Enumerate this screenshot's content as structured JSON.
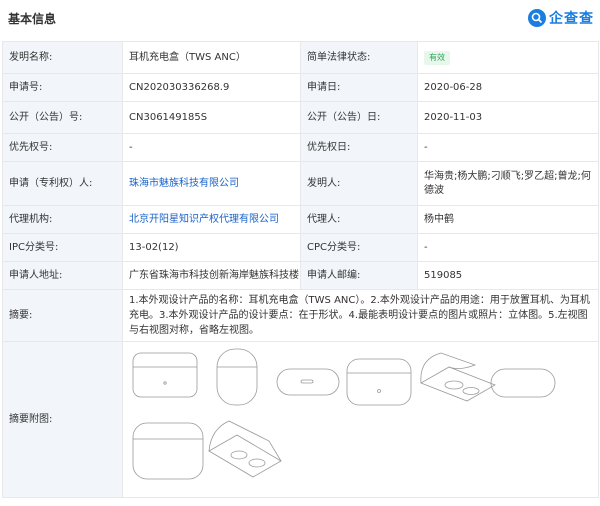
{
  "header": {
    "title": "基本信息",
    "brand": "企查查"
  },
  "rows": {
    "design_name_label": "发明名称:",
    "design_name": "耳机充电盒（TWS ANC）",
    "legal_status_label": "简单法律状态:",
    "legal_status": "有效",
    "app_no_label": "申请号:",
    "app_no": "CN202030336268.9",
    "app_date_label": "申请日:",
    "app_date": "2020-06-28",
    "pub_no_label": "公开（公告）号:",
    "pub_no": "CN306149185S",
    "pub_date_label": "公开（公告）日:",
    "pub_date": "2020-11-03",
    "priority_label": "优先权号:",
    "priority": "-",
    "priority_date_label": "优先权日:",
    "priority_date": "-",
    "applicant_label": "申请（专利权）人:",
    "applicant": "珠海市魅族科技有限公司",
    "inventor_label": "发明人:",
    "inventor": "华海贵;杨大鹏;刁顺飞;罗乙超;曾龙;何德波",
    "agency_label": "代理机构:",
    "agency": "北京开阳星知识产权代理有限公司",
    "agent_label": "代理人:",
    "agent": "杨中鹤",
    "ipc_label": "IPC分类号:",
    "ipc": "13-02(12)",
    "cpc_label": "CPC分类号:",
    "cpc": "-",
    "address_label": "申请人地址:",
    "address": "广东省珠海市科技创新海岸魅族科技楼",
    "postcode_label": "申请人邮编:",
    "postcode": "519085",
    "abstract_label": "摘要:",
    "abstract": "1.本外观设计产品的名称：耳机充电盒（TWS ANC）。2.本外观设计产品的用途：用于放置耳机、为耳机充电。3.本外观设计产品的设计要点：在于形状。4.最能表明设计要点的图片或照片：立体图。5.左视图与右视图对称，省略左视图。",
    "drawing_label": "摘要附图:"
  },
  "colors": {
    "accent": "#1a7ee0",
    "link": "#1a62c9",
    "status_green": "#2da557",
    "label_bg": "#f2f6fb"
  }
}
